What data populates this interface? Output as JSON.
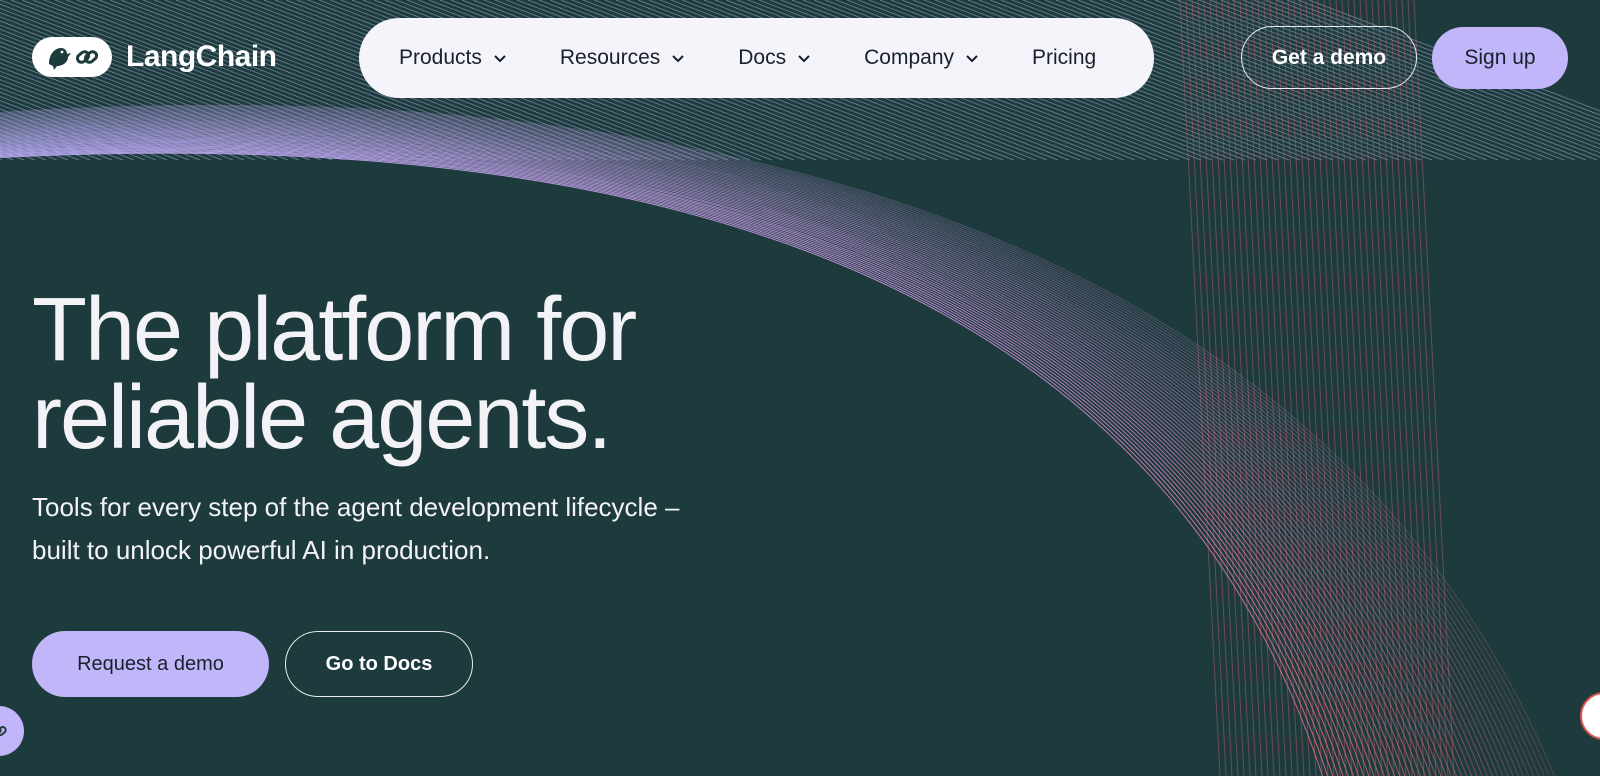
{
  "brand": {
    "name": "LangChain"
  },
  "nav": {
    "items": [
      {
        "label": "Products",
        "has_dropdown": true
      },
      {
        "label": "Resources",
        "has_dropdown": true
      },
      {
        "label": "Docs",
        "has_dropdown": true
      },
      {
        "label": "Company",
        "has_dropdown": true
      },
      {
        "label": "Pricing",
        "has_dropdown": false
      }
    ],
    "dropdown_icon": "chevron-down-icon"
  },
  "header_actions": {
    "get_demo_label": "Get a demo",
    "sign_up_label": "Sign up"
  },
  "hero": {
    "headline": "The platform for reliable agents.",
    "subtitle": "Tools for every step of the agent development lifecycle – built to unlock powerful AI in production.",
    "primary_button_label": "Request a demo",
    "secondary_button_label": "Go to Docs"
  },
  "colors": {
    "background": "#1d3a3c",
    "accent": "#c1b6f9",
    "nav_background": "#f5f4fb",
    "text_light": "#f3f3f7",
    "text_dark": "#17212b"
  }
}
